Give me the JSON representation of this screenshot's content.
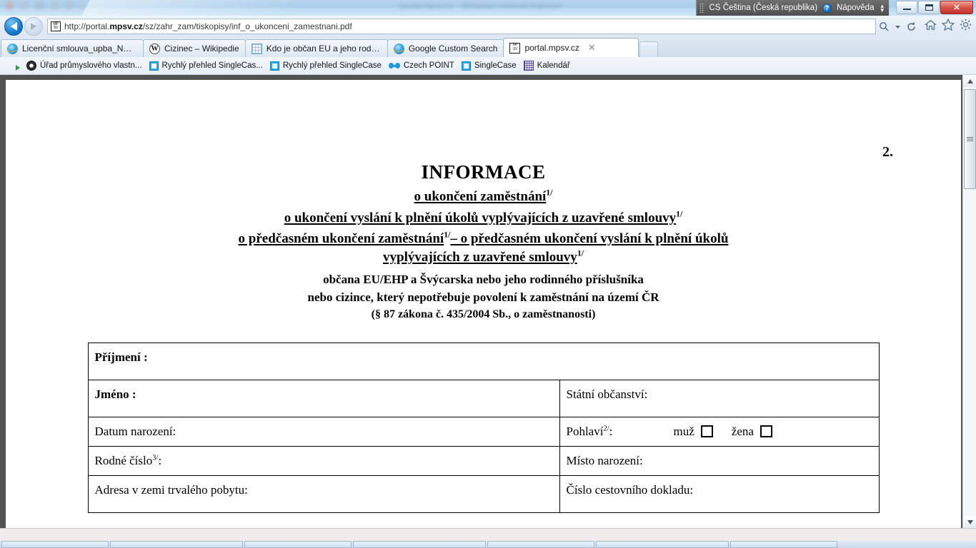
{
  "window": {
    "title_blurred": "portal.mpsv.cz - Windows Internet Explorer",
    "minimize_label": "Minimalizovat",
    "maximize_label": "Maximalizovat",
    "close_label": "Zavřít"
  },
  "language_bar": {
    "language": "CS Čeština (Česká republika)",
    "help_label": "Nápověda",
    "help_icon_glyph": "?"
  },
  "navigation": {
    "back_label": "Zpět",
    "forward_label": "Vpřed",
    "url": "http://portal.mpsv.cz/sz/zahr_zam/tiskopisy/inf_o_ukonceni_zamestnani.pdf",
    "url_domain": "mpsv.cz",
    "url_prefix": "http://portal.",
    "url_suffix": "/sz/zahr_zam/tiskopisy/inf_o_ukonceni_zamestnani.pdf",
    "favicon": "mpsv-icon",
    "icons": [
      "search-icon",
      "dropdown-arrow-icon",
      "refresh-icon",
      "home-icon",
      "favorites-star-icon",
      "settings-gear-icon"
    ]
  },
  "tabs": [
    {
      "label": "Licenční smlouva_upba_NAKU...",
      "icon": "ie-icon",
      "active": false,
      "closable": false
    },
    {
      "label": "Cizinec – Wikipedie",
      "icon": "wikipedia-icon",
      "active": false,
      "closable": false
    },
    {
      "label": "Kdo je občan EU a jeho rodinn...",
      "icon": "chart-icon",
      "active": false,
      "closable": false
    },
    {
      "label": "Google Custom Search",
      "icon": "ie-icon",
      "active": false,
      "closable": false
    },
    {
      "label": "portal.mpsv.cz",
      "icon": "mpsv-icon",
      "active": true,
      "closable": true,
      "close_glyph": "✕"
    }
  ],
  "bookmarks": [
    {
      "label": "Úřad průmyslového vlastn...",
      "icon": "disc-icon"
    },
    {
      "label": "Rychlý přehled  SingleCas...",
      "icon": "blue-square-icon"
    },
    {
      "label": "Rychlý přehled  SingleCase",
      "icon": "blue-square-icon"
    },
    {
      "label": "Czech POINT",
      "icon": "czechpoint-icon"
    },
    {
      "label": "SingleCase",
      "icon": "blue-square-icon"
    },
    {
      "label": "Kalendář",
      "icon": "calendar-icon"
    }
  ],
  "document": {
    "page_marker": "2.",
    "title_main": "INFORMACE",
    "title_line2": "o ukončení zaměstnání",
    "title_line2_sup": "1/",
    "title_line3": "o ukončení vyslání k plnění úkolů vyplývajících z uzavřené smlouvy",
    "title_line3_sup": "1/",
    "title_line4a": "o předčasném ukončení zaměstnání",
    "title_line4a_sup": "1/",
    "title_line4b": "– o předčasném ukončení vyslání k plnění úkolů",
    "title_line5": "vyplývajících z uzavřené smlouvy",
    "title_line5_sup": "1/",
    "subtitle1": "občana  EU/EHP a Švýcarska nebo jeho rodinného příslušníka",
    "subtitle2": "nebo cizince, který nepotřebuje povolení k zaměstnání na území ČR",
    "legal_reference": "(§ 87 zákona č. 435/2004 Sb., o zaměstnanosti)",
    "form": {
      "surname_label": "Příjmení :",
      "firstname_label": "Jméno :",
      "citizenship_label": "Státní občanství:",
      "birthdate_label": "Datum narození:",
      "gender_label": "Pohlaví",
      "gender_sup": "2/",
      "gender_colon": ":",
      "gender_male": "muž",
      "gender_female": "žena",
      "birthnumber_label": "Rodné číslo",
      "birthnumber_sup": "3/",
      "birthnumber_colon": ":",
      "birthplace_label": "Místo narození:",
      "address_label": "Adresa v zemi trvalého pobytu:",
      "travel_document_label": "Číslo cestovního dokladu:"
    }
  },
  "scrollbar": {
    "up_label": "Nahoru",
    "down_label": "Dolů"
  },
  "colors": {
    "accent_blue": "#1479c9",
    "viewer_gray": "#535353",
    "close_red": "#c0322a"
  }
}
